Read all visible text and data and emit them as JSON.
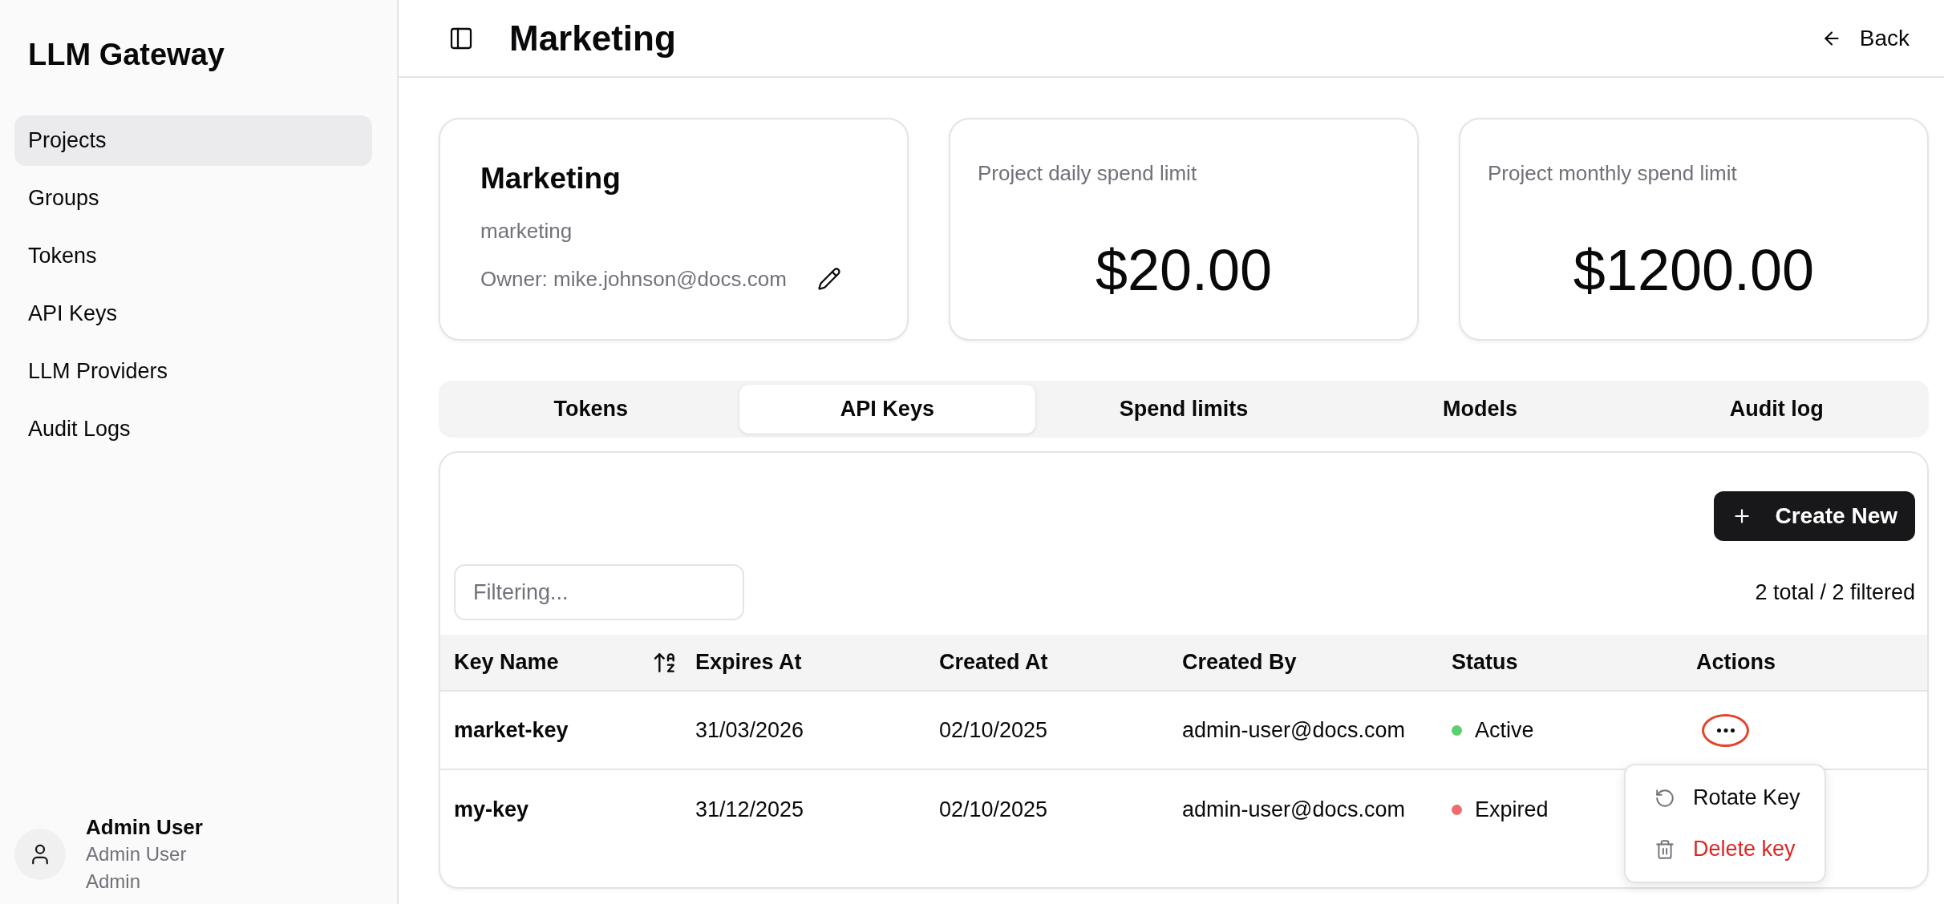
{
  "sidebar": {
    "title": "LLM Gateway",
    "items": [
      {
        "label": "Projects",
        "selected": true
      },
      {
        "label": "Groups",
        "selected": false
      },
      {
        "label": "Tokens",
        "selected": false
      },
      {
        "label": "API Keys",
        "selected": false
      },
      {
        "label": "LLM Providers",
        "selected": false
      },
      {
        "label": "Audit Logs",
        "selected": false
      }
    ],
    "user": {
      "name": "Admin User",
      "display_name": "Admin User",
      "role": "Admin"
    }
  },
  "header": {
    "title": "Marketing",
    "back_label": "Back"
  },
  "project_card": {
    "name": "Marketing",
    "slug": "marketing",
    "owner": "Owner: mike.johnson@docs.com"
  },
  "limit_cards": [
    {
      "label": "Project daily spend limit",
      "value": "$20.00"
    },
    {
      "label": "Project monthly spend limit",
      "value": "$1200.00"
    }
  ],
  "tabs": [
    {
      "label": "Tokens",
      "selected": false
    },
    {
      "label": "API Keys",
      "selected": true
    },
    {
      "label": "Spend limits",
      "selected": false
    },
    {
      "label": "Models",
      "selected": false
    },
    {
      "label": "Audit log",
      "selected": false
    }
  ],
  "api_keys": {
    "create_button": "Create New",
    "filter": {
      "placeholder": "Filtering..."
    },
    "count": "2 total / 2 filtered",
    "columns": [
      {
        "label": "Key Name",
        "sorted": true
      },
      {
        "label": "Expires At",
        "sorted": false
      },
      {
        "label": "Created At",
        "sorted": false
      },
      {
        "label": "Created By",
        "sorted": false
      },
      {
        "label": "Status",
        "sorted": false
      },
      {
        "label": "Actions",
        "sorted": false
      }
    ],
    "rows": [
      {
        "key_name": "market-key",
        "expires_at": "31/03/2026",
        "created_at": "02/10/2025",
        "created_by": "admin-user@docs.com",
        "status": {
          "label": "Active",
          "color": "#5cd06c"
        },
        "actions": {
          "highlighted": true,
          "menu": [
            {
              "label": "Rotate Key",
              "kind": "rotate"
            },
            {
              "label": "Delete key",
              "kind": "delete"
            }
          ]
        }
      },
      {
        "key_name": "my-key",
        "expires_at": "31/12/2025",
        "created_at": "02/10/2025",
        "created_by": "admin-user@docs.com",
        "status": {
          "label": "Expired",
          "color": "#f06b6b"
        }
      }
    ]
  }
}
